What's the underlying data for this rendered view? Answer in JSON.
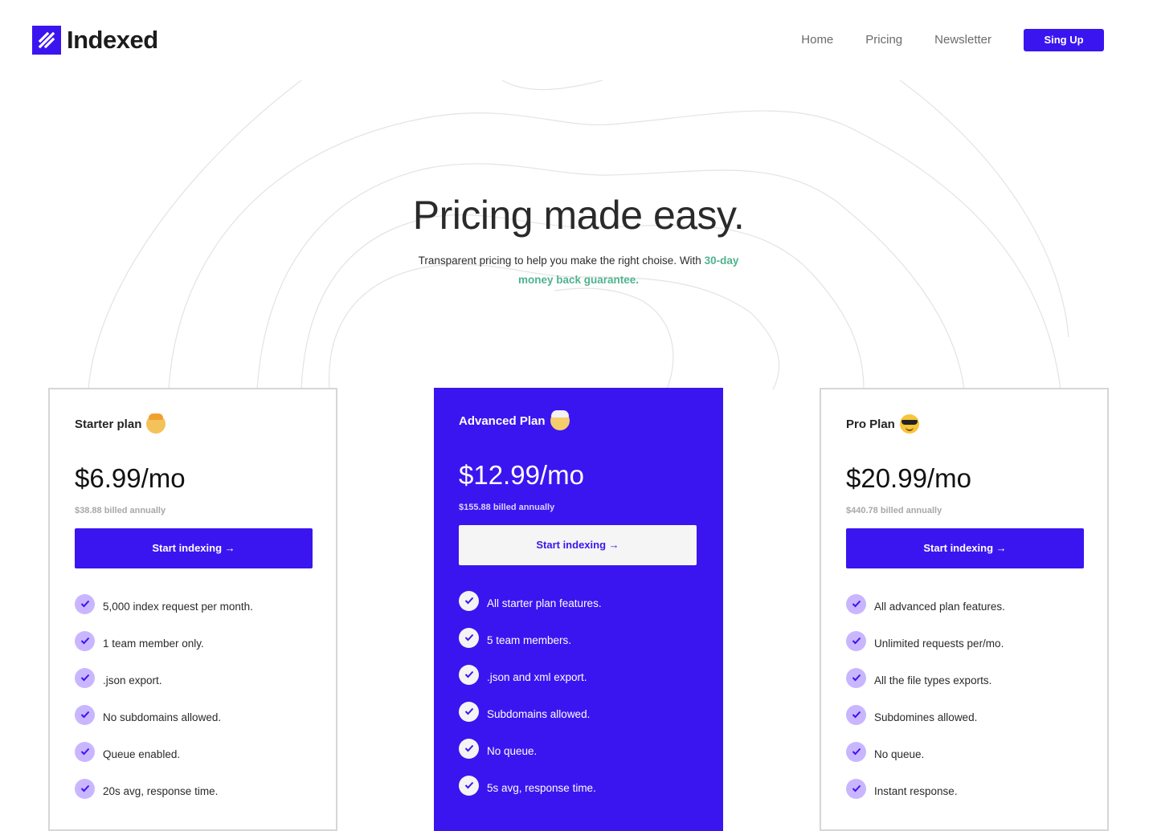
{
  "brand": {
    "name": "Indexed",
    "logo_icon": "indexed-logo-icon",
    "accent": "#3b15f0"
  },
  "nav": {
    "links": [
      "Home",
      "Pricing",
      "Newsletter"
    ],
    "cta_label": "Sing Up"
  },
  "hero": {
    "title": "Pricing made easy.",
    "subtitle": "Transparent pricing to help you make the right choise. With ",
    "subtitle_accent": "30-day money back guarantee.",
    "accent_color": "#4fb38e"
  },
  "plans": [
    {
      "name": "Starter plan",
      "emoji": "baby-emoji",
      "price": "$6.99/mo",
      "billed": "$38.88 billed annually",
      "cta": "Start indexing →",
      "features": [
        "5,000 index request per month.",
        "1 team member only.",
        ".json export.",
        "No subdomains allowed.",
        "Queue enabled.",
        "20s avg, response time."
      ]
    },
    {
      "name": "Advanced Plan",
      "emoji": "old-man-emoji",
      "price": "$12.99/mo",
      "billed": "$155.88 billed annually",
      "cta": "Start indexing →",
      "features": [
        "All starter plan features.",
        "5 team members.",
        ".json and xml export.",
        "Subdomains allowed.",
        "No queue.",
        "5s avg, response time."
      ]
    },
    {
      "name": "Pro Plan",
      "emoji": "sunglasses-emoji",
      "price": "$20.99/mo",
      "billed": "$440.78 billed annually",
      "cta": "Start indexing →",
      "features": [
        "All advanced plan features.",
        "Unlimited requests per/mo.",
        "All the file types exports.",
        "Subdomines allowed.",
        "No queue.",
        "Instant response."
      ]
    }
  ]
}
